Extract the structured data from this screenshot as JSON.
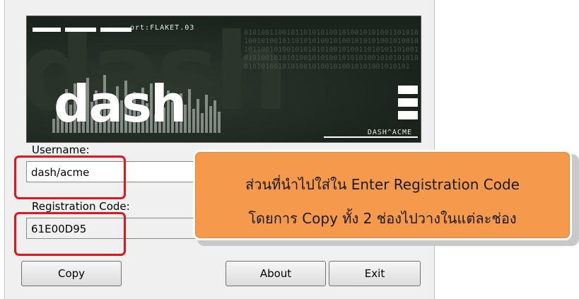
{
  "banner": {
    "credit": "ort:FLAKET.03",
    "brand": "dash",
    "tag": "DASH^ACME",
    "binary": "01010011001011010101001010010101001101010100101001011010101001010010101010010100101011001010010101010100101001101010110100101010010101010010101001010101001010101010010101001010100101001010010101001010101"
  },
  "form": {
    "username_label": "Username:",
    "username_value": "dash/acme",
    "regcode_label": "Registration Code:",
    "regcode_value": "61E00D95"
  },
  "buttons": {
    "copy": "Copy",
    "about": "About",
    "exit": "Exit"
  },
  "callout": {
    "line1": "ส่วนที่นำไปใส่ใน Enter Registration Code",
    "line2": "โดยการ Copy ทั้ง 2 ช่องไปวางในแต่ละช่อง"
  },
  "colors": {
    "highlight": "#e3161c",
    "callout_fill": "#f59a4c"
  }
}
